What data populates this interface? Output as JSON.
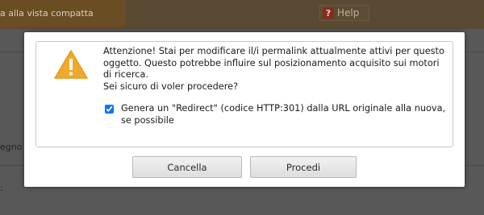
{
  "background": {
    "notice_text": "a alla vista compatta",
    "help_label": "Help",
    "help_icon_glyph": "?",
    "side_text_1": "egno",
    "side_text_2": ":"
  },
  "dialog": {
    "message_lines": [
      "Attenzione! Stai per modificare il/i permalink attualmente attivi per questo",
      "oggetto. Questo potrebbe influire sul posizionamento acquisito sui motori",
      "di ricerca.",
      "Sei sicuro di voler procedere?"
    ],
    "redirect_checkbox": {
      "checked": true,
      "label": "Genera un \"Redirect\" (codice HTTP:301) dalla URL originale alla nuova, se possibile"
    },
    "cancel_label": "Cancella",
    "proceed_label": "Procedi",
    "icon": "warning-triangle-icon"
  },
  "colors": {
    "warning_icon": "#f0a92a"
  }
}
